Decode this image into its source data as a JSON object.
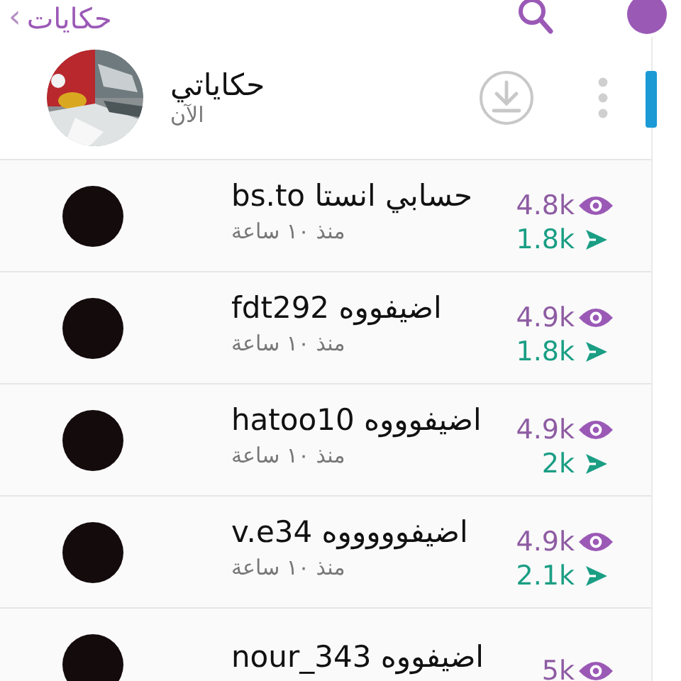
{
  "header": {
    "back": "‹",
    "title": "حكايات"
  },
  "my_story": {
    "title": "حكاياتي",
    "time": "الآن"
  },
  "stories": [
    {
      "title": "حسابي انستا bs.to",
      "time": "منذ ١٠ ساعة",
      "views": "4.8k",
      "replies": "1.8k"
    },
    {
      "title": "اضيفووه fdt292",
      "time": "منذ ١٠ ساعة",
      "views": "4.9k",
      "replies": "1.8k"
    },
    {
      "title": "اضيفوووه hatoo10",
      "time": "منذ ١٠ ساعة",
      "views": "4.9k",
      "replies": "2k"
    },
    {
      "title": "اضيفوووووه v.e34",
      "time": "منذ ١٠ ساعة",
      "views": "4.9k",
      "replies": "2.1k"
    },
    {
      "title": "اضيفووه nour_343",
      "views": "5k"
    }
  ]
}
